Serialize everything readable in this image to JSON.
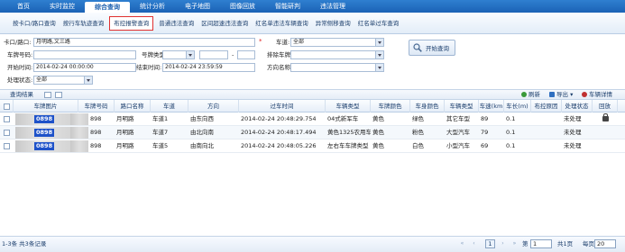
{
  "nav": {
    "items": [
      "首页",
      "实时监控",
      "综合查询",
      "统计分析",
      "电子地图",
      "图像回放",
      "智能研判",
      "违法管理"
    ],
    "active_index": 2
  },
  "subnav": {
    "items": [
      "按卡口/路口查询",
      "按行车轨迹查询",
      "布控报警查询",
      "普通违法查询",
      "区间超速违法查询",
      "红名单违法车辆查询",
      "异常侧移查询",
      "红名单过车查询"
    ],
    "active_index": 2
  },
  "filters": {
    "checkpoint_label": "卡口/路口:",
    "checkpoint_value": "月明路,文三路",
    "lane_label": "车道:",
    "lane_value": "全部",
    "plate_label": "车牌号码:",
    "plate_type_label": "号牌类型:",
    "exclude_plate_label": "排除车牌:",
    "start_label": "开始时间:",
    "start_value": "2014-02-24 00:00:00",
    "end_label": "结束时间:",
    "end_value": "2014-02-24 23:59:59",
    "direction_label": "方向名称:",
    "status_label": "处理状态:",
    "status_value": "全部",
    "search_button": "开始查询",
    "dash": "-"
  },
  "grid": {
    "title": "查询结果",
    "refresh": "刷新",
    "export": "导出",
    "detail": "车辆详情"
  },
  "columns": [
    "车牌图片",
    "车牌号码",
    "路口名称",
    "车道",
    "方向",
    "过车时间",
    "车辆类型",
    "车牌颜色",
    "车身颜色",
    "车辆类型",
    "车速(km",
    "车长(m)",
    "布控原因",
    "处理状态",
    "回放"
  ],
  "rows": [
    {
      "plate_tail": "0898",
      "plate_no": "898",
      "road": "月明路",
      "lane": "车道1",
      "direction": "由东向西",
      "time": "2014-02-24 20:48:29.754",
      "veh_type": "04式新军车",
      "plate_color": "黄色",
      "body_color": "绿色",
      "veh_class": "其它车型",
      "speed": "89",
      "length": "0.1",
      "reason": "",
      "status": "未处理",
      "playback": true
    },
    {
      "plate_tail": "0898",
      "plate_no": "898",
      "road": "月明路",
      "lane": "车道7",
      "direction": "由北向南",
      "time": "2014-02-24 20:48:17.494",
      "veh_type": "黄色1325农用车",
      "plate_color": "黄色",
      "body_color": "粉色",
      "veh_class": "大型汽车",
      "speed": "79",
      "length": "0.1",
      "reason": "",
      "status": "未处理",
      "playback": false
    },
    {
      "plate_tail": "0898",
      "plate_no": "898",
      "road": "月明路",
      "lane": "车道5",
      "direction": "由南向北",
      "time": "2014-02-24 20:48:05.226",
      "veh_type": "左右车车牌类型",
      "plate_color": "黄色",
      "body_color": "白色",
      "veh_class": "小型汽车",
      "speed": "69",
      "length": "0.1",
      "reason": "",
      "status": "未处理",
      "playback": false
    }
  ],
  "footer": {
    "info": "1-3条 共3条记录",
    "page_current": "1",
    "page_prefix": "第",
    "page_input": "1",
    "page_suffix": "共1页",
    "per_page_label": "每页",
    "per_page": "20"
  },
  "colors": {
    "nav_blue": "#1b62b5",
    "plate_blue": "#1e52c9",
    "active_border": "#e03030"
  }
}
